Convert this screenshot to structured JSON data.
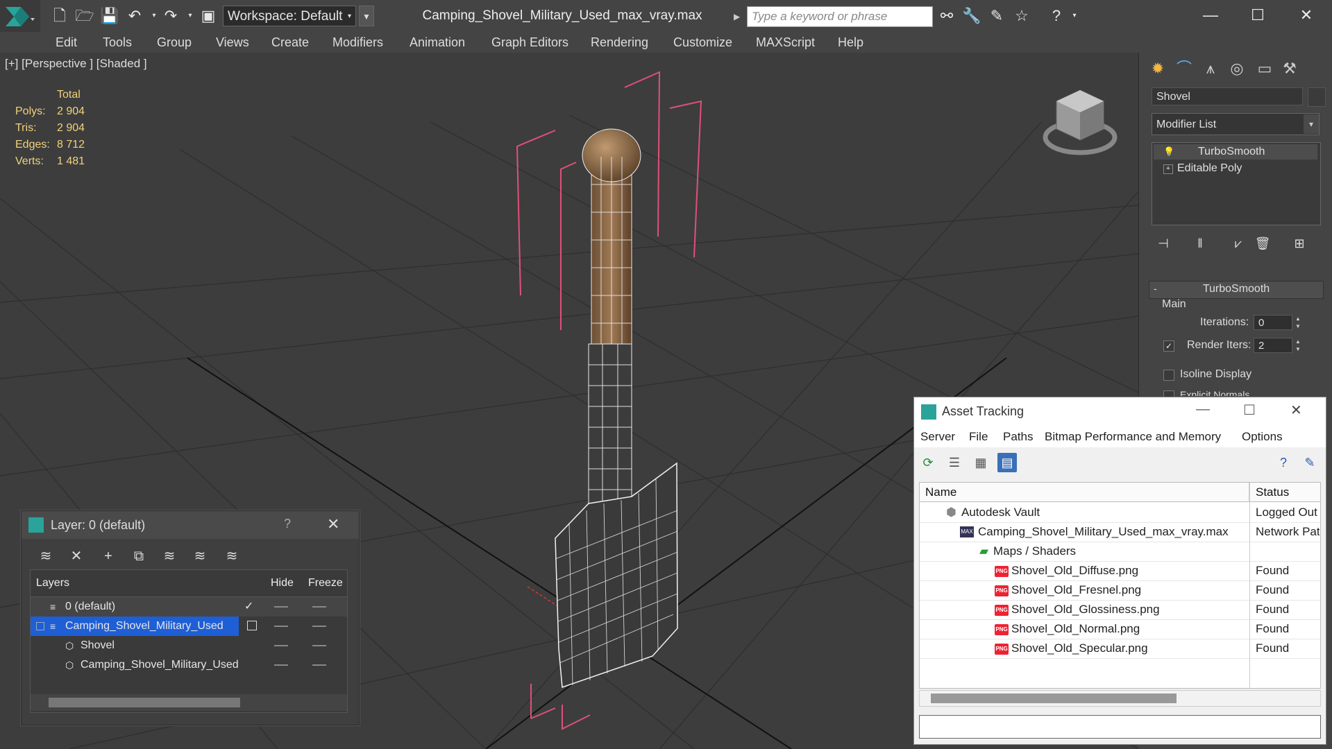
{
  "titlebar": {
    "workspace_label": "Workspace: Default",
    "document_title": "Camping_Shovel_Military_Used_max_vray.max",
    "search_placeholder": "Type a keyword or phrase"
  },
  "menu": [
    "Edit",
    "Tools",
    "Group",
    "Views",
    "Create",
    "Modifiers",
    "Animation",
    "Graph Editors",
    "Rendering",
    "Customize",
    "MAXScript",
    "Help"
  ],
  "viewport": {
    "label": "[+] [Perspective ] [Shaded ]",
    "stats_header": "Total",
    "stats": [
      {
        "label": "Polys:",
        "value": "2 904"
      },
      {
        "label": "Tris:",
        "value": "2 904"
      },
      {
        "label": "Edges:",
        "value": "8 712"
      },
      {
        "label": "Verts:",
        "value": "1 481"
      }
    ]
  },
  "command_panel": {
    "object_name": "Shovel",
    "modifier_list": "Modifier List",
    "stack": [
      {
        "label": "TurboSmooth"
      },
      {
        "label": "Editable Poly"
      }
    ],
    "rollout_title": "TurboSmooth",
    "group_label": "Main",
    "iterations_label": "Iterations:",
    "iterations_value": "0",
    "render_iters_label": "Render Iters:",
    "render_iters_value": "2",
    "isoline_label": "Isoline Display",
    "explicit_label": "Explicit Normals"
  },
  "layer_dialog": {
    "title": "Layer: 0 (default)",
    "help": "?",
    "col_layers": "Layers",
    "col_hide": "Hide",
    "col_freeze": "Freeze",
    "rows": [
      {
        "label": "0 (default)"
      },
      {
        "label": "Camping_Shovel_Military_Used"
      },
      {
        "label": "Shovel"
      },
      {
        "label": "Camping_Shovel_Military_Used"
      }
    ]
  },
  "asset_tracking": {
    "title": "Asset Tracking",
    "menu": [
      "Server",
      "File",
      "Paths",
      "Bitmap Performance and Memory",
      "Options"
    ],
    "col_name": "Name",
    "col_status": "Status",
    "rows": [
      {
        "name": "Autodesk Vault",
        "status": "Logged Out"
      },
      {
        "name": "Camping_Shovel_Military_Used_max_vray.max",
        "status": "Network Path"
      },
      {
        "name": "Maps / Shaders",
        "status": ""
      },
      {
        "name": "Shovel_Old_Diffuse.png",
        "status": "Found"
      },
      {
        "name": "Shovel_Old_Fresnel.png",
        "status": "Found"
      },
      {
        "name": "Shovel_Old_Glossiness.png",
        "status": "Found"
      },
      {
        "name": "Shovel_Old_Normal.png",
        "status": "Found"
      },
      {
        "name": "Shovel_Old_Specular.png",
        "status": "Found"
      }
    ]
  },
  "colors": {
    "accent_blue": "#1e5fd6",
    "stats_yellow": "#f1d37a",
    "wire_pink": "#e0507a"
  }
}
